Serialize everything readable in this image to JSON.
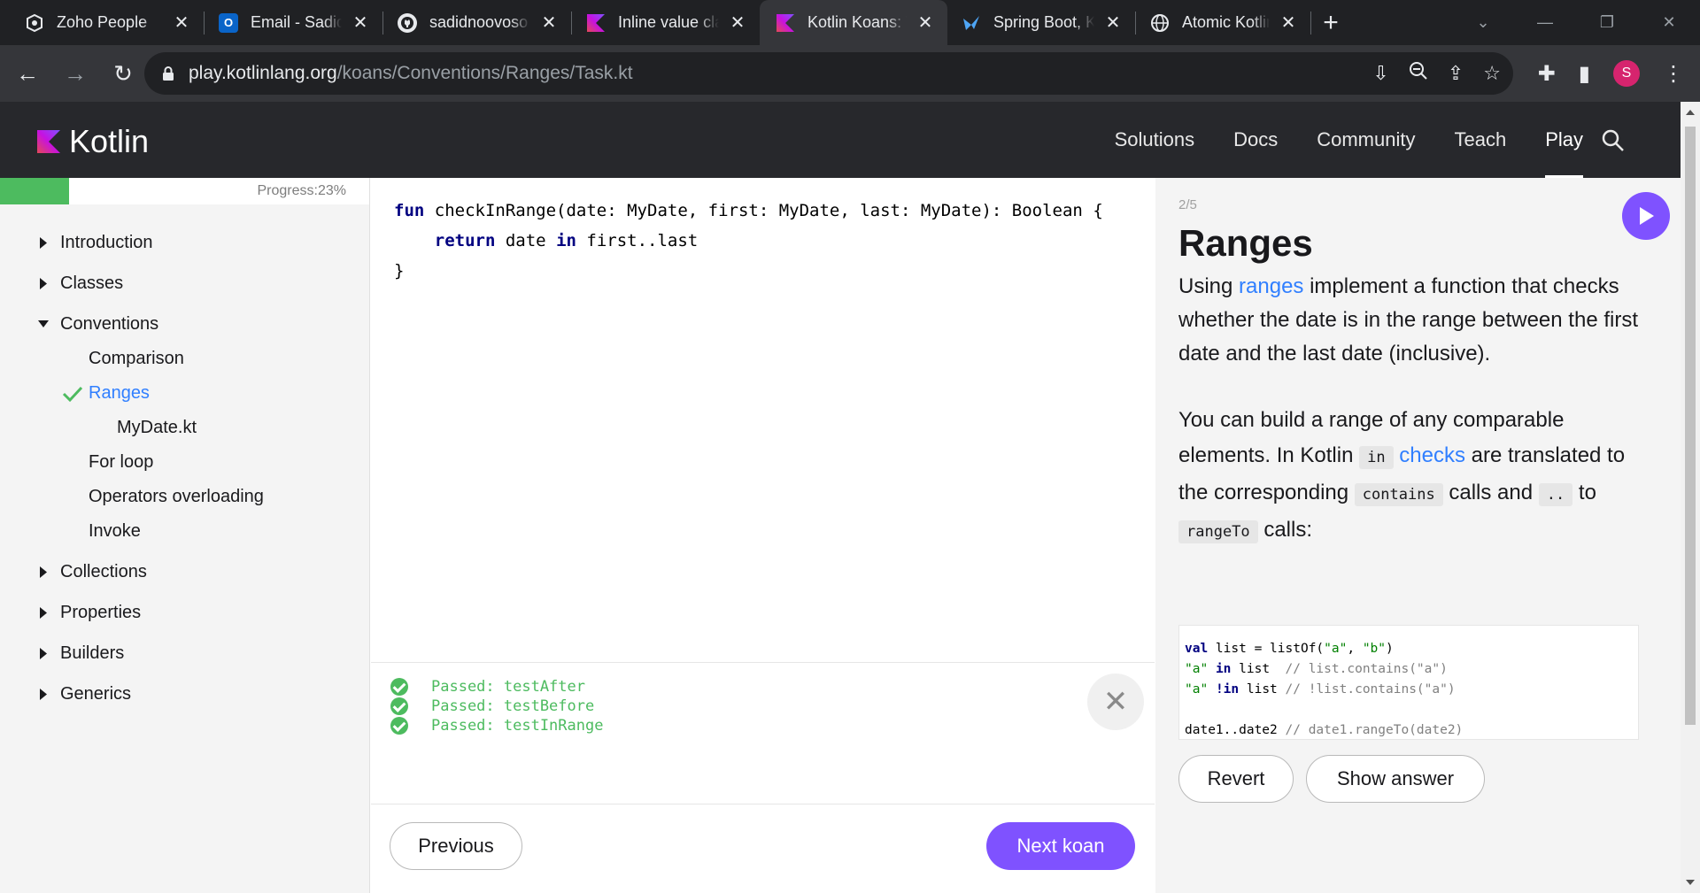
{
  "browser": {
    "tabs": [
      {
        "title": "Zoho People",
        "icon": "zoho-icon",
        "active": false
      },
      {
        "title": "Email - Sadid S",
        "icon": "outlook-icon",
        "active": false
      },
      {
        "title": "sadidnoovoso",
        "icon": "github-icon",
        "active": false
      },
      {
        "title": "Inline value cla",
        "icon": "kotlin-icon",
        "active": false
      },
      {
        "title": "Kotlin Koans: T",
        "icon": "kotlin-icon",
        "active": true
      },
      {
        "title": "Spring Boot, K",
        "icon": "spring-icon",
        "active": false
      },
      {
        "title": "Atomic Kotlin",
        "icon": "globe-icon",
        "active": false
      }
    ],
    "new_tab_label": "+",
    "url_host": "play.kotlinlang.org",
    "url_path": "/koans/Conventions/Ranges/Task.kt",
    "profile_initial": "S"
  },
  "site": {
    "logo_text": "Kotlin",
    "nav": [
      "Solutions",
      "Docs",
      "Community",
      "Teach",
      "Play"
    ],
    "active_nav": "Play"
  },
  "sidebar": {
    "progress_label": "Progress:23%",
    "progress_fraction": 0.23,
    "tree": [
      {
        "label": "Introduction",
        "level": 1,
        "expanded": false
      },
      {
        "label": "Classes",
        "level": 1,
        "expanded": false
      },
      {
        "label": "Conventions",
        "level": 1,
        "expanded": true
      },
      {
        "label": "Comparison",
        "level": 2
      },
      {
        "label": "Ranges",
        "level": 2,
        "active": true,
        "done": true
      },
      {
        "label": "MyDate.kt",
        "level": 3
      },
      {
        "label": "For loop",
        "level": 2
      },
      {
        "label": "Operators overloading",
        "level": 2
      },
      {
        "label": "Invoke",
        "level": 2
      },
      {
        "label": "Collections",
        "level": 1,
        "expanded": false
      },
      {
        "label": "Properties",
        "level": 1,
        "expanded": false
      },
      {
        "label": "Builders",
        "level": 1,
        "expanded": false
      },
      {
        "label": "Generics",
        "level": 1,
        "expanded": false
      }
    ]
  },
  "editor": {
    "lines": [
      "fun checkInRange(date: MyDate, first: MyDate, last: MyDate): Boolean {",
      "    return date in first..last",
      "}"
    ]
  },
  "results": {
    "lines": [
      "Passed: testAfter",
      "Passed: testBefore",
      "Passed: testInRange"
    ]
  },
  "buttons": {
    "previous": "Previous",
    "next": "Next koan",
    "revert": "Revert",
    "show_answer": "Show answer"
  },
  "task": {
    "counter": "2/5",
    "title": "Ranges",
    "p1_before": "Using ",
    "p1_link": "ranges",
    "p1_after": " implement a function that checks whether the date is in the range between the first date and the last date (inclusive).",
    "p2_a": "You can build a range of any comparable elements. In Kotlin ",
    "p2_code1": "in",
    "p2_link": "checks",
    "p2_b": " are translated to the corresponding ",
    "p2_code2": "contains",
    "p2_c": " calls and ",
    "p2_code3": "..",
    "p2_d": " to ",
    "p2_code4": "rangeTo",
    "p2_e": " calls:",
    "snippet": [
      "val list = listOf(\"a\", \"b\")",
      "\"a\" in list  // list.contains(\"a\")",
      "\"a\" !in list // !list.contains(\"a\")",
      "",
      "date1..date2 // date1.rangeTo(date2)"
    ]
  },
  "colors": {
    "accent": "#7f52ff",
    "link": "#307fff",
    "pass": "#4dbb5f",
    "header_bg": "#27282c"
  }
}
